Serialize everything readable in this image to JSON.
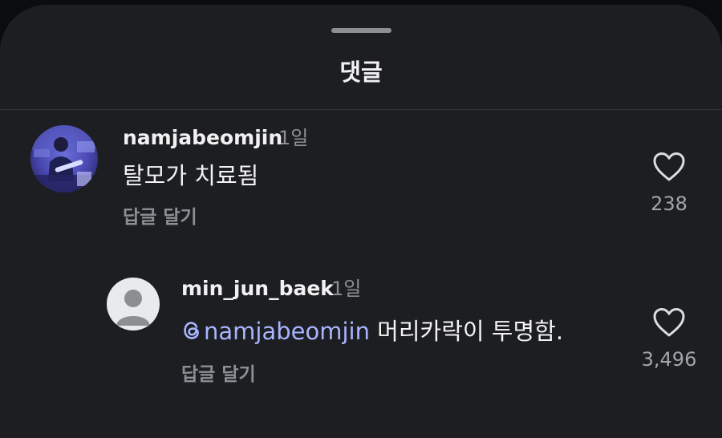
{
  "sheet": {
    "title": "댓글"
  },
  "comments": [
    {
      "username": "namjabeomjin",
      "time": "1일",
      "text": "탈모가 치료됨",
      "reply_label": "답글 달기",
      "like_count": "238",
      "avatar": "profile-photo"
    },
    {
      "username": "min_jun_baek",
      "time": "1일",
      "mention": "namjabeomjin",
      "text": " 머리카락이 투명함.",
      "reply_label": "답글 달기",
      "like_count": "3,496",
      "avatar": "default-avatar"
    }
  ],
  "icons": {
    "like": "heart-outline-icon",
    "mention": "threads-at-icon"
  },
  "colors": {
    "background": "#1c1e21",
    "text": "#f3f3f3",
    "muted": "#8d8f94",
    "mention": "#a9b4ff"
  }
}
